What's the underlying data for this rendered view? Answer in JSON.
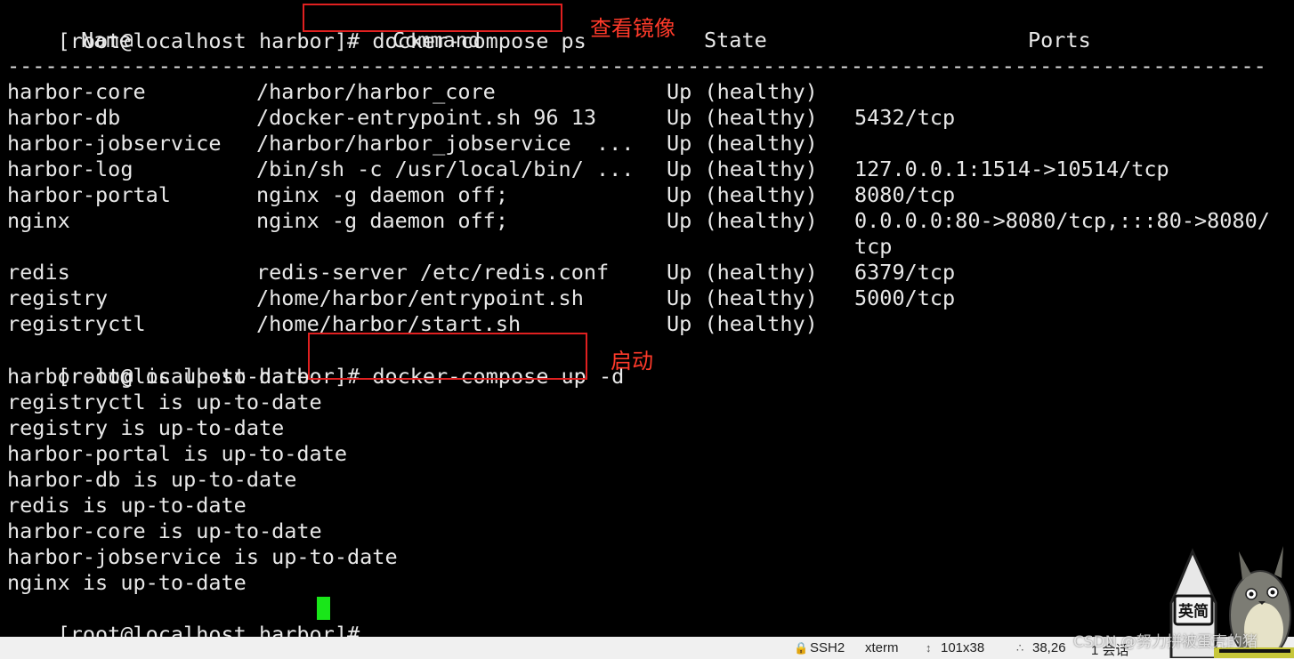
{
  "terminal": {
    "prompt": "[root@localhost harbor]# ",
    "cmd1": "docker-compose ps",
    "cmd2": "docker-compose up -d",
    "headers": {
      "name": "Name",
      "command": "Command",
      "state": "State",
      "ports": "Ports"
    },
    "divider": "-----------------------------------------------------------------------------------------------------",
    "rows": [
      {
        "name": "harbor-core",
        "command": "/harbor/harbor_core",
        "state": "Up (healthy)",
        "ports": ""
      },
      {
        "name": "harbor-db",
        "command": "/docker-entrypoint.sh 96 13",
        "state": "Up (healthy)",
        "ports": "5432/tcp"
      },
      {
        "name": "harbor-jobservice",
        "command": "/harbor/harbor_jobservice  ...",
        "state": "Up (healthy)",
        "ports": ""
      },
      {
        "name": "harbor-log",
        "command": "/bin/sh -c /usr/local/bin/ ...",
        "state": "Up (healthy)",
        "ports": "127.0.0.1:1514->10514/tcp"
      },
      {
        "name": "harbor-portal",
        "command": "nginx -g daemon off;",
        "state": "Up (healthy)",
        "ports": "8080/tcp"
      },
      {
        "name": "nginx",
        "command": "nginx -g daemon off;",
        "state": "Up (healthy)",
        "ports": "0.0.0.0:80->8080/tcp,:::80->8080/"
      },
      {
        "name": "",
        "command": "",
        "state": "",
        "ports": "tcp"
      },
      {
        "name": "redis",
        "command": "redis-server /etc/redis.conf",
        "state": "Up (healthy)",
        "ports": "6379/tcp"
      },
      {
        "name": "registry",
        "command": "/home/harbor/entrypoint.sh",
        "state": "Up (healthy)",
        "ports": "5000/tcp"
      },
      {
        "name": "registryctl",
        "command": "/home/harbor/start.sh",
        "state": "Up (healthy)",
        "ports": ""
      }
    ],
    "output": [
      "harbor-log is up-to-date",
      "registryctl is up-to-date",
      "registry is up-to-date",
      "harbor-portal is up-to-date",
      "harbor-db is up-to-date",
      "redis is up-to-date",
      "harbor-core is up-to-date",
      "harbor-jobservice is up-to-date",
      "nginx is up-to-date"
    ],
    "final_prompt": "[root@localhost harbor]# "
  },
  "annotations": {
    "view_images": "查看镜像",
    "start": "启动",
    "color": "#e02020"
  },
  "statusbar": {
    "protocol": "SSH2",
    "term": "xterm",
    "size": "101x38",
    "cursor_pos": "38,26",
    "sessions": "1 会话"
  },
  "mascot": {
    "badge": "英简"
  },
  "watermark": "CSDN @努力拼被蛋壳的猪",
  "colors": {
    "terminal_bg": "#000000",
    "terminal_fg": "#e8e8e8",
    "cursor": "#19e619",
    "annotation": "#ff3a2a"
  }
}
